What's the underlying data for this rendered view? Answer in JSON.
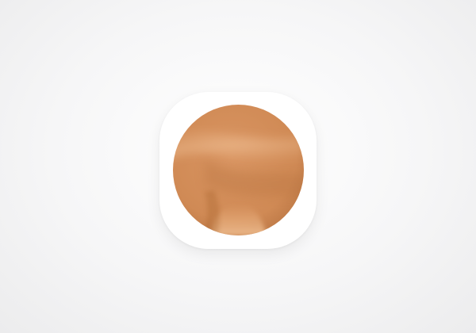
{
  "icon": {
    "name": "circular-artwork-icon",
    "frame_color": "#ffffff",
    "artwork": {
      "base_color": "#d08a55",
      "highlight_color": "#eab887",
      "shadow_color": "#b87442"
    }
  }
}
